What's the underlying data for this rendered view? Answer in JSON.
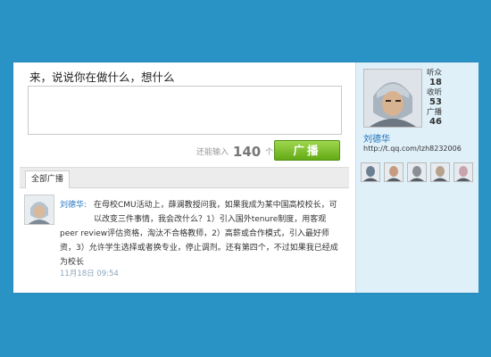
{
  "composer": {
    "prompt": "来，说说你在做什么，想什么",
    "counter_prefix": "还能输入",
    "counter_value": "140",
    "counter_suffix": "个字",
    "broadcast_label": "广播"
  },
  "feed": {
    "tab_label": "全部广播",
    "post": {
      "author": "刘德华:",
      "text": "在母校CMU活动上，薛澜教授问我，如果我成为某中国高校校长，可以改变三件事情，我会改什么？1）引入国外tenure制度，用客观peer review评估资格，淘汰不合格教师，2）高薪或合作模式，引入最好师资，3）允许学生选择或者换专业，停止调剂。还有第四个，不过如果我已经成为校长",
      "time": "11月18日 09:54"
    }
  },
  "profile": {
    "name": "刘德华",
    "url": "http://t.qq.com/lzh8232006",
    "stats": [
      {
        "label": "听众",
        "value": "18"
      },
      {
        "label": "收听",
        "value": "53"
      },
      {
        "label": "广播",
        "value": "46"
      }
    ],
    "following_count": 5
  },
  "colors": {
    "background": "#2a93c6",
    "sidebar": "#dff0f9",
    "accent_green": "#63ab16",
    "link_blue": "#2b78c5"
  }
}
